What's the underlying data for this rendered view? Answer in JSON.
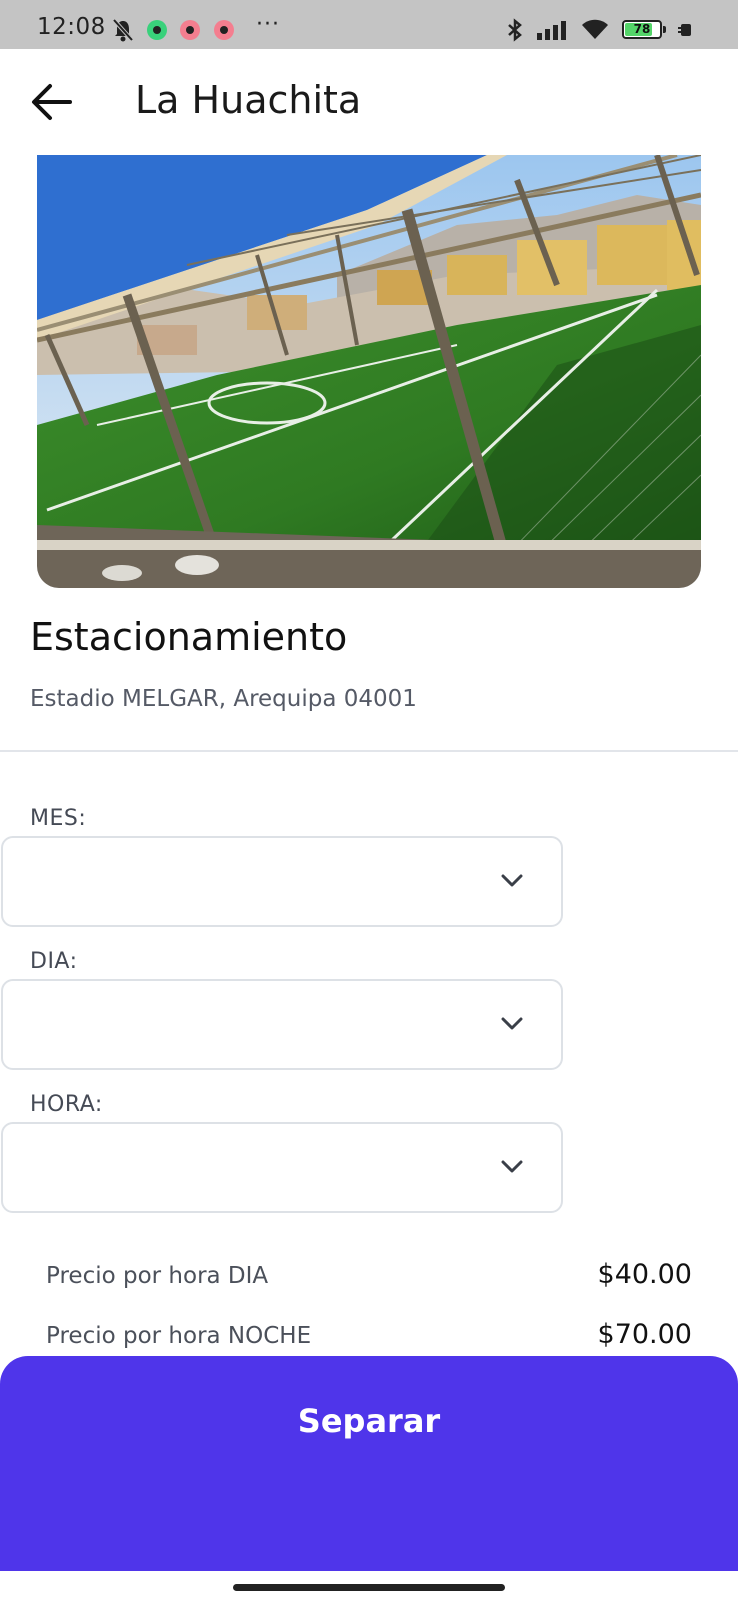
{
  "status_bar": {
    "time": "12:08",
    "more": "···",
    "battery": "78",
    "battery_level": 0.78,
    "colors": {
      "whatsapp": "#39d17b",
      "gmail1": "#f47e8f",
      "gmail2": "#f47e8f"
    }
  },
  "header": {
    "title": "La Huachita",
    "back_icon": "arrow-left-icon"
  },
  "venue": {
    "name": "Estacionamiento",
    "address": "Estadio MELGAR, Arequipa 04001"
  },
  "form": {
    "month_label": "MES:",
    "day_label": "DIA:",
    "hour_label": "HORA:",
    "month_value": "",
    "day_value": "",
    "hour_value": ""
  },
  "prices": [
    {
      "label": "Precio por hora DIA",
      "value": "$40.00"
    },
    {
      "label": "Precio por hora NOCHE",
      "value": "$70.00"
    }
  ],
  "cta": {
    "label": "Separar",
    "color": "#4f35ea"
  }
}
